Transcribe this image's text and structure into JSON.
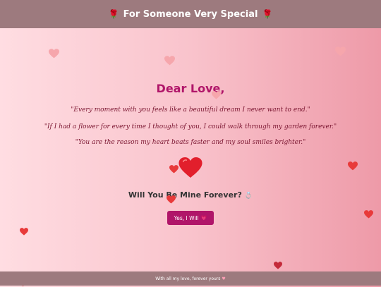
{
  "header": {
    "title": "For Someone Very Special",
    "left_icon": "rose-icon",
    "right_icon": "rose-icon",
    "rose_glyph": "🌹"
  },
  "letter": {
    "greeting": "Dear Love,",
    "quotes": [
      "\"Every moment with you feels like a beautiful dream I never want to end.\"",
      "\"If I had a flower for every time I thought of you, I could walk through my garden forever.\"",
      "\"You are the reason my heart beats faster and my soul smiles brighter.\""
    ]
  },
  "question": {
    "text": "Will You Be Mine Forever?",
    "ring_glyph": "💍"
  },
  "yes_button": {
    "label": "Yes, I Will",
    "heart_glyph": "💗"
  },
  "footer": {
    "text": "With all my love, forever yours",
    "heart_glyph": "♥"
  },
  "colors": {
    "accent": "#b01569",
    "header_bg": "#9d7a7e",
    "heart_red": "#e83a3a",
    "heart_pale": "#f6a6ac",
    "heart_dark": "#c42a3a"
  },
  "floating_hearts": [
    {
      "icon": "heart-icon",
      "tone": "pale"
    },
    {
      "icon": "heart-icon",
      "tone": "pale"
    },
    {
      "icon": "heart-icon",
      "tone": "pale"
    },
    {
      "icon": "heart-icon",
      "tone": "pale"
    },
    {
      "icon": "heart-icon",
      "tone": "red"
    },
    {
      "icon": "heart-icon",
      "tone": "red"
    },
    {
      "icon": "heart-icon",
      "tone": "red"
    },
    {
      "icon": "heart-icon",
      "tone": "red"
    },
    {
      "icon": "heart-icon",
      "tone": "red"
    },
    {
      "icon": "heart-icon",
      "tone": "dark"
    },
    {
      "icon": "heart-icon",
      "tone": "dark"
    },
    {
      "icon": "heart-icon",
      "tone": "pale"
    }
  ]
}
